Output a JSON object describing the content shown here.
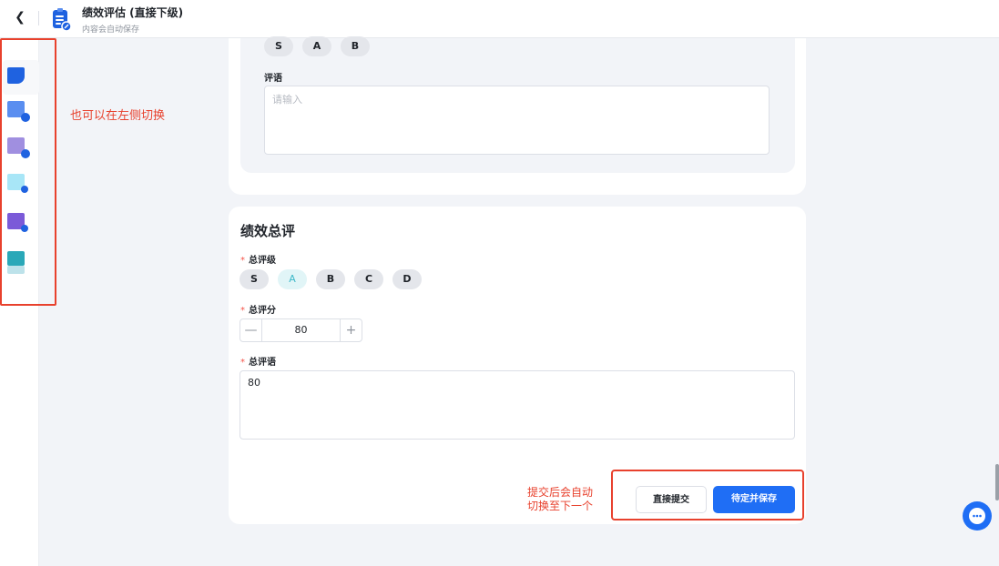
{
  "header": {
    "title": "绩效评估 (直接下级)",
    "subtitle": "内容会自动保存"
  },
  "rail": {
    "items": [
      {
        "color": "#1f62e0",
        "check": "none",
        "active": true
      },
      {
        "color": "#5a8ef0",
        "check": "#1f62e0"
      },
      {
        "color": "#a08fe0",
        "check": "#1f62e0"
      },
      {
        "color": "#a8e6f7",
        "check": "#1f62e0"
      },
      {
        "color": "#7b5ad8",
        "check": "#1f62e0"
      },
      {
        "color": "#2aa8b8",
        "check": "#bde2ea"
      }
    ]
  },
  "annotations": {
    "left_hint": "也可以在左侧切换",
    "submit_hint_line1": "提交后会自动",
    "submit_hint_line2": "切换至下一个"
  },
  "prev_section": {
    "grades": [
      "S",
      "A",
      "B"
    ],
    "comment_label": "评语",
    "comment_placeholder": "请输入"
  },
  "overall": {
    "title": "绩效总评",
    "grade_label": "总评级",
    "grades": [
      "S",
      "A",
      "B",
      "C",
      "D"
    ],
    "selected_grade": "A",
    "score_label": "总评分",
    "score_value": "80",
    "comment_label": "总评语",
    "comment_value": "80"
  },
  "actions": {
    "submit_label": "直接提交",
    "save_label": "待定并保存"
  },
  "colors": {
    "primary": "#1f6ef5",
    "annotation": "#e8412d",
    "selected_grade_bg": "#e1f5f7",
    "selected_grade_text": "#3cb8c8"
  }
}
